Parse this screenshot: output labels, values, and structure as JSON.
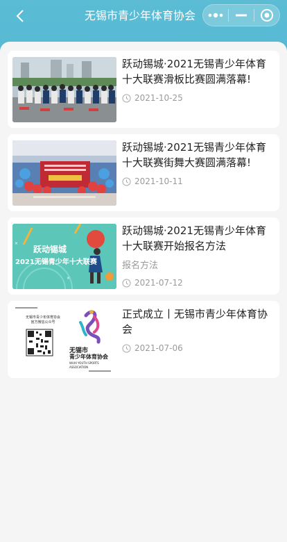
{
  "header": {
    "title": "无锡市青少年体育协会",
    "back_icon": "chevron-left-icon",
    "menu_icon": "more-dots-icon",
    "minimize_icon": "minimize-icon",
    "close_icon": "target-icon"
  },
  "articles": [
    {
      "title": "跃动锡城·2021无锡青少年体育十大联赛滑板比赛圆满落幕!",
      "subtitle": "",
      "date": "2021-10-25"
    },
    {
      "title": "跃动锡城·2021无锡青少年体育十大联赛街舞大赛圆满落幕!",
      "subtitle": "",
      "date": "2021-10-11"
    },
    {
      "title": "跃动锡城·2021无锡青少年体育十大联赛开始报名方法",
      "subtitle": "报名方法",
      "date": "2021-07-12",
      "thumb_text": [
        "跃动锡城",
        "2021无锡青少年十大联赛"
      ]
    },
    {
      "title": "正式成立丨无锡市青少年体育协会",
      "subtitle": "",
      "date": "2021-07-06",
      "thumb_text": [
        "无锡市青少年体育协会",
        "官方微信公众号",
        "无锡市",
        "青少年体育协会",
        "WUXI YOUTH SPORTS",
        "ASSOCIATION"
      ]
    }
  ]
}
